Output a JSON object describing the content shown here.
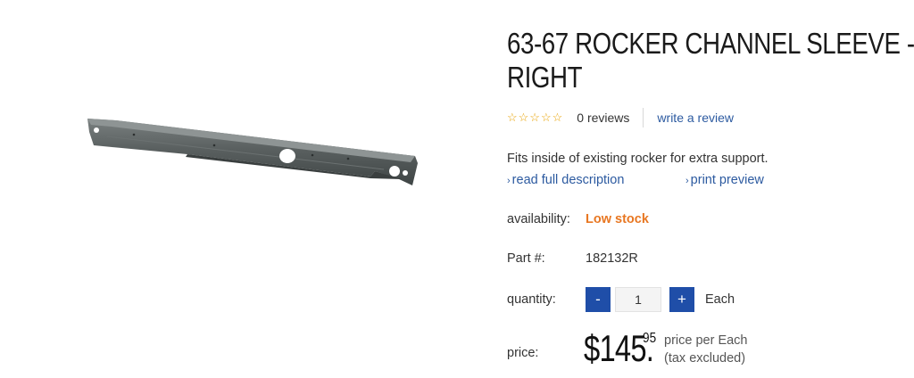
{
  "product": {
    "title_line1": "63-67 ROCKER CHANNEL SLEEVE -",
    "title_line2": "RIGHT",
    "image_alt": "rocker channel sleeve"
  },
  "rating": {
    "stars": "☆☆☆☆☆",
    "reviews": "0 reviews",
    "write_review": "write a review",
    "star_color": "#e8a100"
  },
  "description": {
    "text": "Fits inside of existing rocker for extra support.",
    "read_more": "read full description",
    "print": "print preview",
    "chevron": "›"
  },
  "availability": {
    "label": "availability:",
    "value": "Low stock",
    "color": "#e87722"
  },
  "part": {
    "label": "Part #:",
    "value": "182132R"
  },
  "quantity": {
    "label": "quantity:",
    "minus": "-",
    "value": "1",
    "plus": "+",
    "unit": "Each",
    "button_color": "#1f4ea8"
  },
  "price": {
    "label": "price:",
    "main": "$145.",
    "cents": "95",
    "note1": "price per Each",
    "note2": "(tax excluded)"
  },
  "link_color": "#2c5aa0"
}
